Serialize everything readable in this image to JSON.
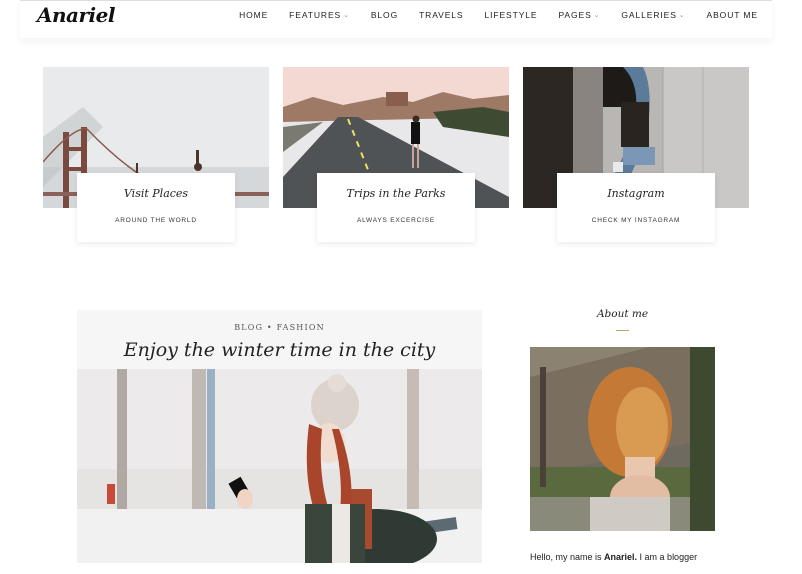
{
  "header": {
    "logo": "Anariel",
    "nav": [
      {
        "label": "HOME",
        "dropdown": false
      },
      {
        "label": "FEATURES",
        "dropdown": true
      },
      {
        "label": "BLOG",
        "dropdown": false
      },
      {
        "label": "TRAVELS",
        "dropdown": false
      },
      {
        "label": "LIFESTYLE",
        "dropdown": false
      },
      {
        "label": "PAGES",
        "dropdown": true
      },
      {
        "label": "GALLERIES",
        "dropdown": true
      },
      {
        "label": "ABOUT ME",
        "dropdown": false
      }
    ]
  },
  "promos": [
    {
      "title": "Visit Places",
      "subtitle": "AROUND THE WORLD"
    },
    {
      "title": "Trips in the Parks",
      "subtitle": "ALWAYS EXCERCISE"
    },
    {
      "title": "Instagram",
      "subtitle": "CHECK MY INSTAGRAM"
    }
  ],
  "post": {
    "categories": "BLOG • FASHION",
    "title": "Enjoy the winter time in the city"
  },
  "sidebar": {
    "title": "About me",
    "intro_prefix": "Hello, my name is ",
    "intro_name": "Anariel.",
    "intro_suffix": " I am a blogger"
  },
  "colors": {
    "accent": "#c9a36a",
    "post_header_bg": "#f6f6f6"
  }
}
